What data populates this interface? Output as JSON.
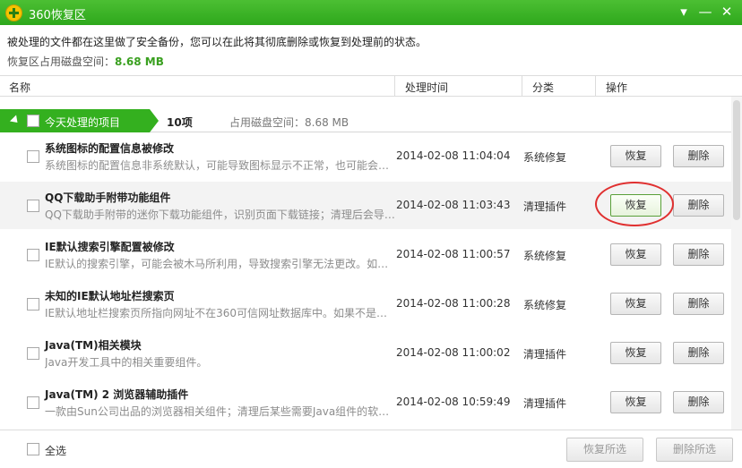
{
  "window": {
    "title": "360恢复区",
    "logo_icon": "360-logo-icon",
    "menu_icon": "dropdown-icon",
    "minimize_icon": "minimize-icon",
    "close_icon": "close-icon",
    "minimize_glyph": "—",
    "close_glyph": "✕",
    "menu_glyph": "▾"
  },
  "info": {
    "description": "被处理的文件都在这里做了安全备份，您可以在此将其彻底删除或恢复到处理前的状态。",
    "usage_label": "恢复区占用磁盘空间：",
    "usage_value": "8.68 MB"
  },
  "columns": {
    "name": "名称",
    "time": "处理时间",
    "category": "分类",
    "action": "操作"
  },
  "group": {
    "label": "今天处理的项目",
    "count": "10项",
    "usage": "占用磁盘空间：8.68 MB"
  },
  "items": [
    {
      "name": "系统图标的配置信息被修改",
      "desc": "系统图标的配置信息非系统默认，可能导致图标显示不正常，也可能会…",
      "time": "2014-02-08 11:04:04",
      "category": "系统修复",
      "restore": "恢复",
      "delete": "删除"
    },
    {
      "name": "QQ下载助手附带功能组件",
      "desc": "QQ下载助手附带的迷你下载功能组件，识别页面下载链接；清理后会导…",
      "time": "2014-02-08 11:03:43",
      "category": "清理插件",
      "restore": "恢复",
      "delete": "删除"
    },
    {
      "name": "IE默认搜索引擎配置被修改",
      "desc": "IE默认的搜索引擎，可能会被木马所利用，导致搜索引擎无法更改。如…",
      "time": "2014-02-08 11:00:57",
      "category": "系统修复",
      "restore": "恢复",
      "delete": "删除"
    },
    {
      "name": "未知的IE默认地址栏搜索页",
      "desc": "IE默认地址栏搜索页所指向网址不在360可信网址数据库中。如果不是您…",
      "time": "2014-02-08 11:00:28",
      "category": "系统修复",
      "restore": "恢复",
      "delete": "删除"
    },
    {
      "name": "Java(TM)相关模块",
      "desc": "Java开发工具中的相关重要组件。",
      "time": "2014-02-08 11:00:02",
      "category": "清理插件",
      "restore": "恢复",
      "delete": "删除"
    },
    {
      "name": "Java(TM) 2 浏览器辅助插件",
      "desc": "一款由Sun公司出品的浏览器相关组件；清理后某些需要Java组件的软…",
      "time": "2014-02-08 10:59:49",
      "category": "清理插件",
      "restore": "恢复",
      "delete": "删除"
    }
  ],
  "footer": {
    "select_all": "全选",
    "restore_selected": "恢复所选",
    "delete_selected": "删除所选"
  }
}
